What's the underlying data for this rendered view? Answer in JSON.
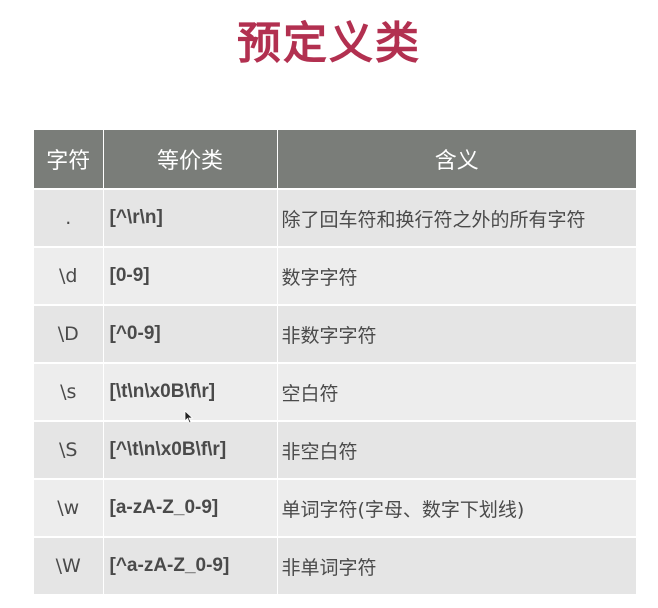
{
  "title": "预定义类",
  "table": {
    "headers": [
      "字符",
      "等价类",
      "含义"
    ],
    "rows": [
      {
        "char": ".",
        "equiv": "[^\\r\\n]",
        "meaning": "除了回车符和换行符之外的所有字符"
      },
      {
        "char": "\\d",
        "equiv": "[0-9]",
        "meaning": "数字字符"
      },
      {
        "char": "\\D",
        "equiv": "[^0-9]",
        "meaning": "非数字字符"
      },
      {
        "char": "\\s",
        "equiv": "[\\t\\n\\x0B\\f\\r]",
        "meaning": "空白符"
      },
      {
        "char": "\\S",
        "equiv": "[^\\t\\n\\x0B\\f\\r]",
        "meaning": "非空白符"
      },
      {
        "char": "\\w",
        "equiv": "[a-zA-Z_0-9]",
        "meaning": "单词字符(字母、数字下划线)"
      },
      {
        "char": "\\W",
        "equiv": "[^a-zA-Z_0-9]",
        "meaning": "非单词字符"
      }
    ]
  },
  "colors": {
    "title": "#b23050",
    "header_bg": "#7a7d79",
    "row_bg": "#ededed"
  },
  "icons": {
    "cursor": "mouse-pointer-icon"
  }
}
